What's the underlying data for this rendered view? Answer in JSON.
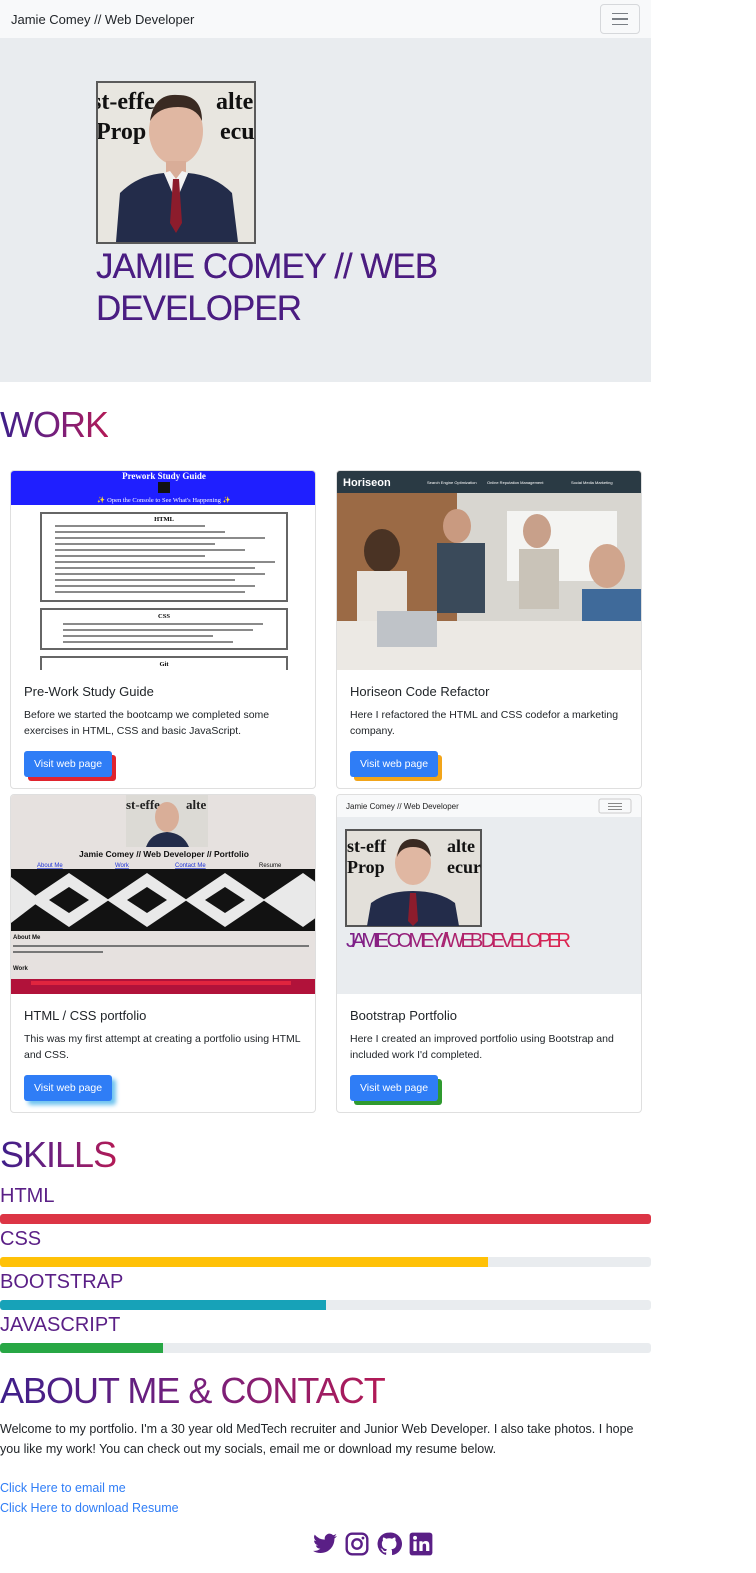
{
  "navbar": {
    "brand": "Jamie Comey // Web Developer"
  },
  "hero": {
    "title": "JAMIE COMEY // WEB DEVELOPER"
  },
  "work": {
    "heading": "WORK",
    "cards": [
      {
        "title": "Pre-Work Study Guide",
        "text": "Before we started the bootcamp we completed some exercises in HTML, CSS and basic JavaScript.",
        "button": "Visit web page",
        "shadow": "#e0242e"
      },
      {
        "title": "Horiseon Code Refactor",
        "text": "Here I refactored the HTML and CSS codefor a marketing company.",
        "button": "Visit web page",
        "shadow": "#f2a51a"
      },
      {
        "title": "HTML / CSS portfolio",
        "text": "This was my first attempt at creating a portfolio using HTML and CSS.",
        "button": "Visit web page",
        "shadow": "#6fc4f0"
      },
      {
        "title": "Bootstrap Portfolio",
        "text": "Here I created an improved portfolio using Bootstrap and included work I'd completed.",
        "button": "Visit web page",
        "shadow": "#2f9a2f"
      }
    ],
    "thumbs": {
      "prework_title": "Prework Study Guide",
      "prework_sub": "✨ Open the Console to See What's Happening ✨",
      "prework_html": "HTML",
      "prework_css": "CSS",
      "prework_git": "Git",
      "horiseon_logo": "Horiseon",
      "horiseon_nav": [
        "Search Engine Optimization",
        "Online Reputation Management",
        "Social Media Marketing"
      ],
      "portfolio_title": "Jamie Comey // Web Developer // Portfolio",
      "portfolio_nav": [
        "About Me",
        "Work",
        "Contact Me",
        "Resume"
      ],
      "portfolio_about": "About Me",
      "portfolio_work": "Work",
      "bootstrap_brand": "Jamie Comey // Web Developer",
      "bootstrap_title": "JAMIE COMEY // WEB DEVELOPER"
    }
  },
  "skills": {
    "heading": "SKILLS",
    "items": [
      {
        "label": "HTML",
        "level": 1.0,
        "color": "#dc3545"
      },
      {
        "label": "CSS",
        "level": 0.75,
        "color": "#ffc107"
      },
      {
        "label": "BOOTSTRAP",
        "level": 0.5,
        "color": "#17a2b8"
      },
      {
        "label": "JAVASCRIPT",
        "level": 0.25,
        "color": "#28a745"
      }
    ]
  },
  "about": {
    "heading": "ABOUT ME & CONTACT",
    "text": "Welcome to my portfolio. I'm a 30 year old MedTech recruiter and Junior Web Developer. I also take photos. I hope you like my work! You can check out my socials, email me or download my resume below.",
    "email_link": "Click Here to email me",
    "resume_link": "Click Here to download Resume"
  },
  "socials": [
    "twitter-icon",
    "instagram-icon",
    "github-icon",
    "linkedin-icon"
  ],
  "colors": {
    "accent": "#5a1f86",
    "button": "#2f7df6"
  }
}
